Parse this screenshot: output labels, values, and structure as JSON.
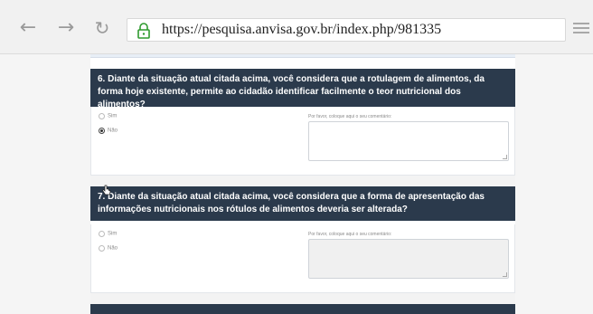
{
  "browser": {
    "back_icon": "arrow-left-icon",
    "forward_icon": "arrow-right-icon",
    "reload_icon": "reload-icon",
    "lock_icon": "lock-icon",
    "menu_icon": "hamburger-menu-icon",
    "url": "https://pesquisa.anvisa.gov.br/index.php/981335"
  },
  "questions": [
    {
      "title": "6. Diante da situação atual citada acima, você considera que a rotulagem de alimentos, da forma hoje existente, permite ao cidadão identificar facilmente o teor nutricional dos alimentos?",
      "options": [
        "Sim",
        "Não"
      ],
      "selected": "Não",
      "comment_label": "Por favor, coloque aqui o seu comentário:",
      "comment_value": ""
    },
    {
      "title": "7. Diante da situação atual citada acima, você considera que a forma de apresentação das informações nutricionais nos rótulos de alimentos deveria ser alterada?",
      "options": [
        "Sim",
        "Não"
      ],
      "selected": "",
      "comment_label": "Por favor, coloque aqui o seu comentário:",
      "comment_value": ""
    }
  ],
  "colors": {
    "header_bg": "#2b3a4c",
    "header_text": "#ffffff"
  }
}
